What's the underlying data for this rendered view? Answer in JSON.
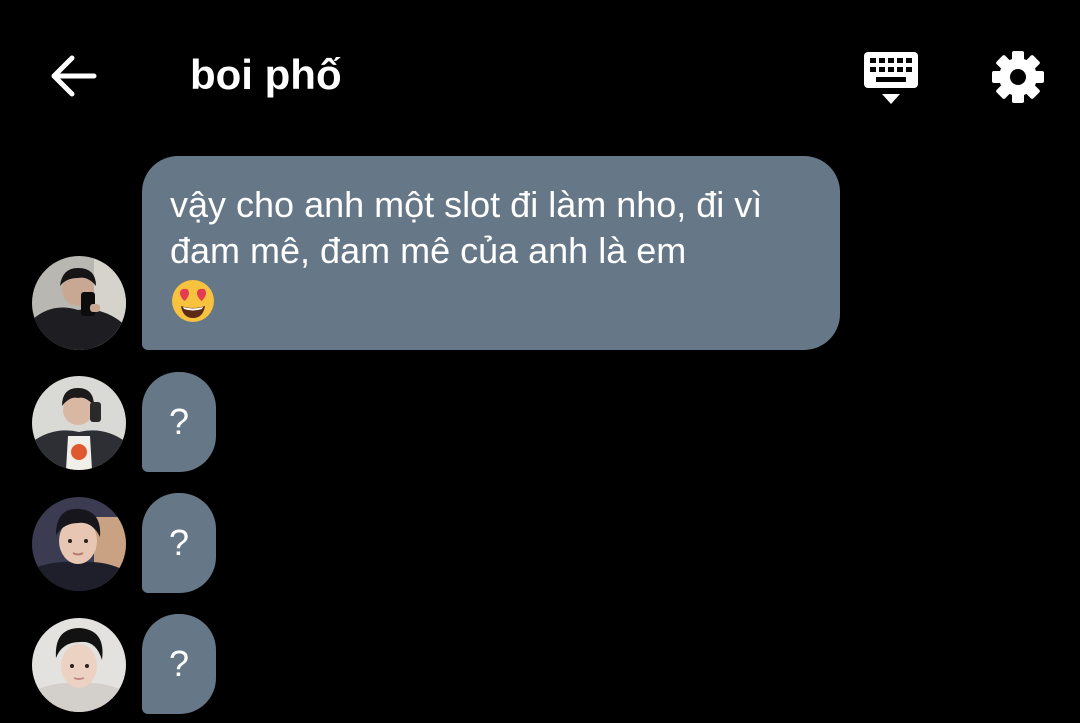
{
  "header": {
    "title": "boi phố",
    "back_icon": "arrow-left-icon",
    "keyboard_icon": "keyboard-hide-icon",
    "settings_icon": "gear-icon"
  },
  "colors": {
    "background": "#000000",
    "bubble": "#667788",
    "text": "#ffffff"
  },
  "messages": [
    {
      "text": "vậy cho anh một slot đi làm nho, đi vì đam mê, đam mê của anh là em",
      "emoji": "smiling-face-heart-eyes-icon"
    },
    {
      "text": "?"
    },
    {
      "text": "?"
    },
    {
      "text": "?"
    }
  ]
}
